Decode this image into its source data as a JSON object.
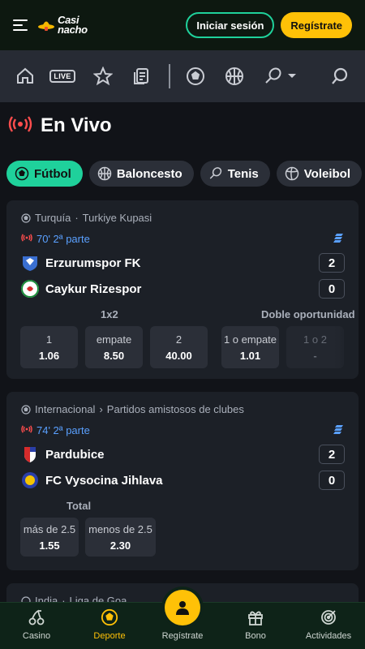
{
  "header": {
    "logo_line1": "Casi",
    "logo_line2": "nacho",
    "login_label": "Iniciar sesión",
    "register_label": "Regístrate"
  },
  "nav": {
    "icons": [
      "home-icon",
      "live-icon",
      "star-icon",
      "betslip-icon",
      "soccer-icon",
      "basketball-icon",
      "tennis-icon",
      "chevron-down-icon",
      "search-icon"
    ],
    "live_label": "LIVE"
  },
  "page": {
    "title": "En Vivo"
  },
  "chips": [
    {
      "label": "Fútbol",
      "active": true
    },
    {
      "label": "Baloncesto",
      "active": false
    },
    {
      "label": "Tenis",
      "active": false
    },
    {
      "label": "Voleibol",
      "active": false
    }
  ],
  "matches": [
    {
      "country": "Turquía",
      "competition": "Turkiye Kupasi",
      "time": "70' 2ª parte",
      "home": "Erzurumspor FK",
      "away": "Caykur Rizespor",
      "home_score": "2",
      "away_score": "0",
      "market1_label": "1x2",
      "market2_label": "Doble oportunidad",
      "odds1": [
        {
          "label": "1",
          "value": "1.06"
        },
        {
          "label": "empate",
          "value": "8.50"
        },
        {
          "label": "2",
          "value": "40.00"
        }
      ],
      "odds2": [
        {
          "label": "1 o empate",
          "value": "1.01"
        },
        {
          "label": "1 o 2",
          "value": "-"
        }
      ]
    },
    {
      "country": "Internacional",
      "competition": "Partidos amistosos de clubes",
      "time": "74' 2ª parte",
      "home": "Pardubice",
      "away": "FC Vysocina Jihlava",
      "home_score": "2",
      "away_score": "0",
      "market1_label": "Total",
      "odds1": [
        {
          "label": "más de 2.5",
          "value": "1.55"
        },
        {
          "label": "menos de 2.5",
          "value": "2.30"
        }
      ]
    },
    {
      "country": "India",
      "competition": "Liga de Goa"
    }
  ],
  "bottom_nav": [
    {
      "label": "Casino",
      "icon": "cherries-icon",
      "active": false
    },
    {
      "label": "Deporte",
      "icon": "soccer-ball-icon",
      "active": true
    },
    {
      "label": "Regístrate",
      "icon": "user-icon",
      "active": false
    },
    {
      "label": "Bono",
      "icon": "gift-icon",
      "active": false
    },
    {
      "label": "Actividades",
      "icon": "target-icon",
      "active": false
    }
  ],
  "colors": {
    "accent_green": "#1fd19b",
    "accent_yellow": "#ffc107",
    "live_red": "#ff4d4d",
    "live_blue": "#5aa0ff"
  }
}
